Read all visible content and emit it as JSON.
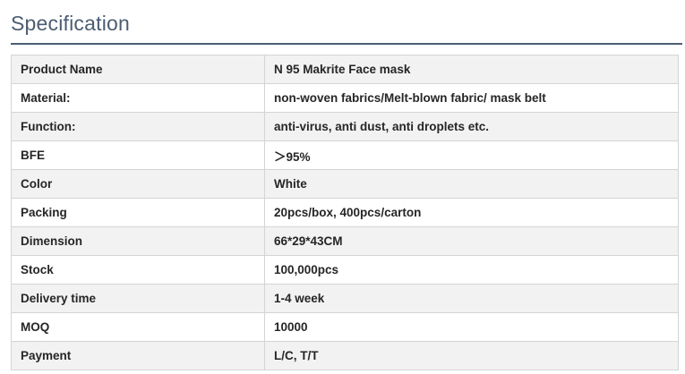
{
  "section": {
    "title": "Specification"
  },
  "spec_table": {
    "rows": [
      {
        "label": "Product Name",
        "value": "N 95 Makrite Face mask"
      },
      {
        "label": "Material:",
        "value": "non-woven fabrics/Melt-blown fabric/ mask belt"
      },
      {
        "label": "Function:",
        "value": "anti-virus, anti dust, anti droplets etc."
      },
      {
        "label": "BFE",
        "value": "＞95%"
      },
      {
        "label": "Color",
        "value": "White"
      },
      {
        "label": "Packing",
        "value": "20pcs/box, 400pcs/carton"
      },
      {
        "label": "Dimension",
        "value": "66*29*43CM"
      },
      {
        "label": "Stock",
        "value": "100,000pcs"
      },
      {
        "label": "Delivery time",
        "value": "1-4 week"
      },
      {
        "label": "MOQ",
        "value": "10000"
      },
      {
        "label": "Payment",
        "value": "L/C, T/T"
      }
    ]
  }
}
